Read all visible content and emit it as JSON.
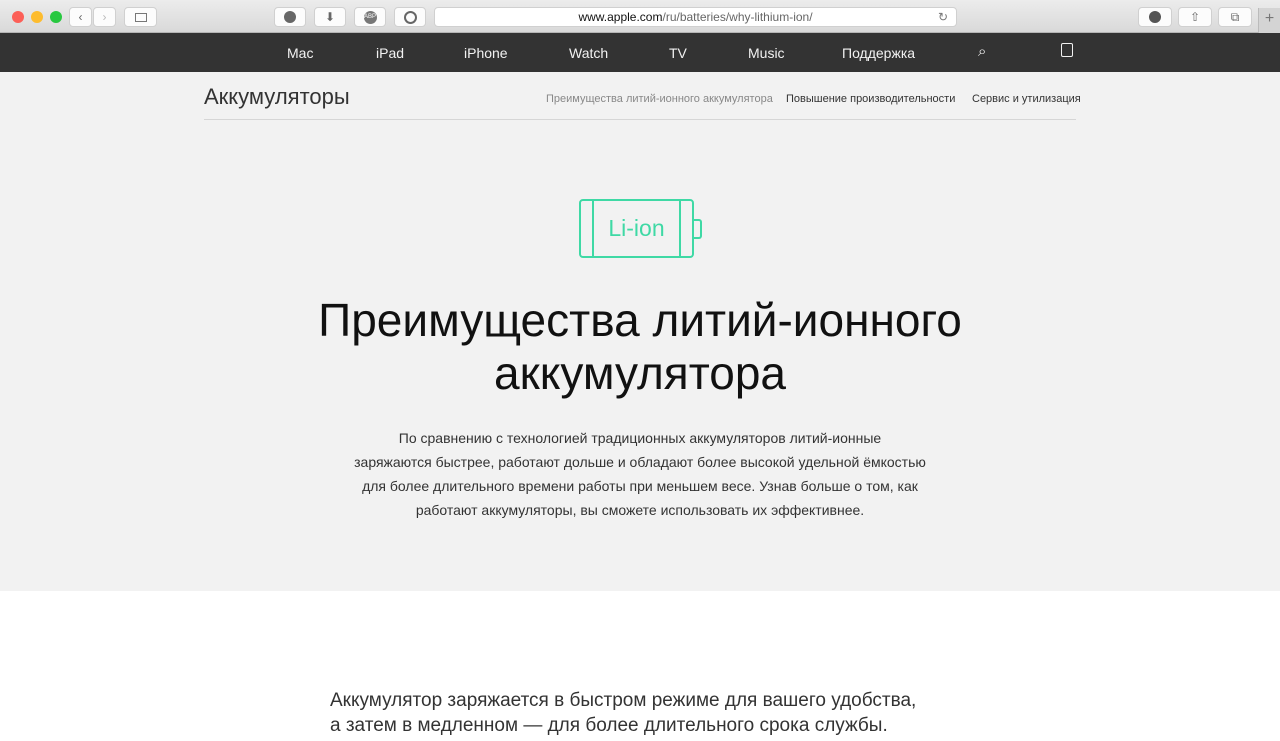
{
  "browser": {
    "url_domain": "www.apple.com",
    "url_path": "/ru/batteries/why-lithium-ion/",
    "abp_label": "ABP",
    "new_tab": "+"
  },
  "nav": {
    "items": [
      "Mac",
      "iPad",
      "iPhone",
      "Watch",
      "TV",
      "Music",
      "Поддержка"
    ]
  },
  "subnav": {
    "title": "Аккумуляторы",
    "links": [
      "Преимущества литий-ионного аккумулятора",
      "Повышение производительности",
      "Сервис и утилизация"
    ]
  },
  "hero": {
    "battery_label": "Li-ion",
    "heading_line1": "Преимущества литий-ионного",
    "heading_line2": "аккумулятора",
    "intro": [
      "По сравнению с технологией традиционных аккумуляторов литий-ионные",
      "заряжаются быстрее, работают дольше и обладают более высокой удельной ёмкостью",
      "для более длительного времени работы при меньшем весе. Узнав больше о том, как",
      "работают аккумуляторы, вы сможете использовать их эффективнее."
    ]
  },
  "section": {
    "lines": [
      "Аккумулятор заряжается в быстром режиме для вашего удобства,",
      "а затем в медленном — для более длительного срока службы."
    ]
  },
  "colors": {
    "accent": "#3fd9a5",
    "nav_bg": "#333333",
    "page_bg": "#f2f2f2"
  }
}
